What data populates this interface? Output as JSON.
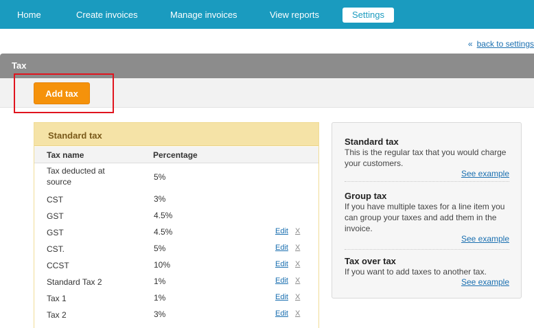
{
  "nav": {
    "items": [
      {
        "label": "Home"
      },
      {
        "label": "Create invoices"
      },
      {
        "label": "Manage invoices"
      },
      {
        "label": "View reports"
      },
      {
        "label": "Settings"
      }
    ]
  },
  "back_link": {
    "label": "back to settings",
    "arrow": "«"
  },
  "section": {
    "title": "Tax"
  },
  "actions": {
    "add_tax_label": "Add tax"
  },
  "standard_tax": {
    "title": "Standard tax",
    "columns": {
      "name": "Tax name",
      "percentage": "Percentage"
    },
    "edit_label": "Edit",
    "delete_label": "X",
    "rows": [
      {
        "name": "Tax deducted at source",
        "percentage": "5%"
      },
      {
        "name": "CST",
        "percentage": "3%"
      },
      {
        "name": "GST",
        "percentage": "4.5%"
      },
      {
        "name": "GST",
        "percentage": "4.5%"
      },
      {
        "name": "CST.",
        "percentage": "5%"
      },
      {
        "name": "CCST",
        "percentage": "10%"
      },
      {
        "name": "Standard Tax 2",
        "percentage": "1%"
      },
      {
        "name": "Tax 1",
        "percentage": "1%"
      },
      {
        "name": "Tax 2",
        "percentage": "3%"
      }
    ]
  },
  "info": {
    "blocks": [
      {
        "title": "Standard tax",
        "description": "This is the regular tax that you would charge your customers.",
        "link": "See example"
      },
      {
        "title": "Group tax",
        "description": "If you have multiple taxes for a line item you can group your taxes and add them in the invoice.",
        "link": "See example"
      },
      {
        "title": "Tax over tax",
        "description": "If you want to add taxes to another tax.",
        "link": "See example"
      }
    ]
  },
  "colors": {
    "nav_bg": "#1a9bbf",
    "accent_orange": "#f5920b",
    "highlight_red": "#e0141e",
    "panel_header": "#f5e3a7",
    "link": "#1a6fb0"
  }
}
